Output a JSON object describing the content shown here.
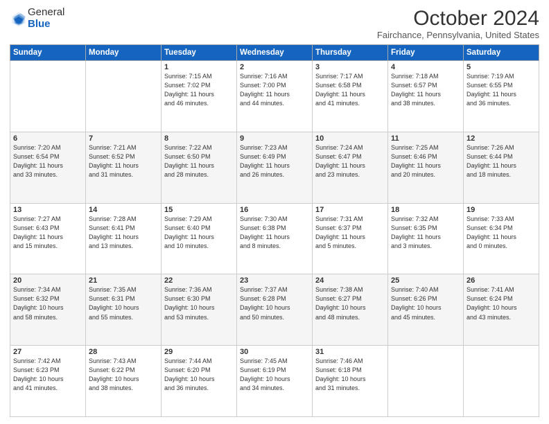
{
  "header": {
    "logo_general": "General",
    "logo_blue": "Blue",
    "month_title": "October 2024",
    "location": "Fairchance, Pennsylvania, United States"
  },
  "days_of_week": [
    "Sunday",
    "Monday",
    "Tuesday",
    "Wednesday",
    "Thursday",
    "Friday",
    "Saturday"
  ],
  "weeks": [
    [
      {
        "num": "",
        "info": ""
      },
      {
        "num": "",
        "info": ""
      },
      {
        "num": "1",
        "info": "Sunrise: 7:15 AM\nSunset: 7:02 PM\nDaylight: 11 hours\nand 46 minutes."
      },
      {
        "num": "2",
        "info": "Sunrise: 7:16 AM\nSunset: 7:00 PM\nDaylight: 11 hours\nand 44 minutes."
      },
      {
        "num": "3",
        "info": "Sunrise: 7:17 AM\nSunset: 6:58 PM\nDaylight: 11 hours\nand 41 minutes."
      },
      {
        "num": "4",
        "info": "Sunrise: 7:18 AM\nSunset: 6:57 PM\nDaylight: 11 hours\nand 38 minutes."
      },
      {
        "num": "5",
        "info": "Sunrise: 7:19 AM\nSunset: 6:55 PM\nDaylight: 11 hours\nand 36 minutes."
      }
    ],
    [
      {
        "num": "6",
        "info": "Sunrise: 7:20 AM\nSunset: 6:54 PM\nDaylight: 11 hours\nand 33 minutes."
      },
      {
        "num": "7",
        "info": "Sunrise: 7:21 AM\nSunset: 6:52 PM\nDaylight: 11 hours\nand 31 minutes."
      },
      {
        "num": "8",
        "info": "Sunrise: 7:22 AM\nSunset: 6:50 PM\nDaylight: 11 hours\nand 28 minutes."
      },
      {
        "num": "9",
        "info": "Sunrise: 7:23 AM\nSunset: 6:49 PM\nDaylight: 11 hours\nand 26 minutes."
      },
      {
        "num": "10",
        "info": "Sunrise: 7:24 AM\nSunset: 6:47 PM\nDaylight: 11 hours\nand 23 minutes."
      },
      {
        "num": "11",
        "info": "Sunrise: 7:25 AM\nSunset: 6:46 PM\nDaylight: 11 hours\nand 20 minutes."
      },
      {
        "num": "12",
        "info": "Sunrise: 7:26 AM\nSunset: 6:44 PM\nDaylight: 11 hours\nand 18 minutes."
      }
    ],
    [
      {
        "num": "13",
        "info": "Sunrise: 7:27 AM\nSunset: 6:43 PM\nDaylight: 11 hours\nand 15 minutes."
      },
      {
        "num": "14",
        "info": "Sunrise: 7:28 AM\nSunset: 6:41 PM\nDaylight: 11 hours\nand 13 minutes."
      },
      {
        "num": "15",
        "info": "Sunrise: 7:29 AM\nSunset: 6:40 PM\nDaylight: 11 hours\nand 10 minutes."
      },
      {
        "num": "16",
        "info": "Sunrise: 7:30 AM\nSunset: 6:38 PM\nDaylight: 11 hours\nand 8 minutes."
      },
      {
        "num": "17",
        "info": "Sunrise: 7:31 AM\nSunset: 6:37 PM\nDaylight: 11 hours\nand 5 minutes."
      },
      {
        "num": "18",
        "info": "Sunrise: 7:32 AM\nSunset: 6:35 PM\nDaylight: 11 hours\nand 3 minutes."
      },
      {
        "num": "19",
        "info": "Sunrise: 7:33 AM\nSunset: 6:34 PM\nDaylight: 11 hours\nand 0 minutes."
      }
    ],
    [
      {
        "num": "20",
        "info": "Sunrise: 7:34 AM\nSunset: 6:32 PM\nDaylight: 10 hours\nand 58 minutes."
      },
      {
        "num": "21",
        "info": "Sunrise: 7:35 AM\nSunset: 6:31 PM\nDaylight: 10 hours\nand 55 minutes."
      },
      {
        "num": "22",
        "info": "Sunrise: 7:36 AM\nSunset: 6:30 PM\nDaylight: 10 hours\nand 53 minutes."
      },
      {
        "num": "23",
        "info": "Sunrise: 7:37 AM\nSunset: 6:28 PM\nDaylight: 10 hours\nand 50 minutes."
      },
      {
        "num": "24",
        "info": "Sunrise: 7:38 AM\nSunset: 6:27 PM\nDaylight: 10 hours\nand 48 minutes."
      },
      {
        "num": "25",
        "info": "Sunrise: 7:40 AM\nSunset: 6:26 PM\nDaylight: 10 hours\nand 45 minutes."
      },
      {
        "num": "26",
        "info": "Sunrise: 7:41 AM\nSunset: 6:24 PM\nDaylight: 10 hours\nand 43 minutes."
      }
    ],
    [
      {
        "num": "27",
        "info": "Sunrise: 7:42 AM\nSunset: 6:23 PM\nDaylight: 10 hours\nand 41 minutes."
      },
      {
        "num": "28",
        "info": "Sunrise: 7:43 AM\nSunset: 6:22 PM\nDaylight: 10 hours\nand 38 minutes."
      },
      {
        "num": "29",
        "info": "Sunrise: 7:44 AM\nSunset: 6:20 PM\nDaylight: 10 hours\nand 36 minutes."
      },
      {
        "num": "30",
        "info": "Sunrise: 7:45 AM\nSunset: 6:19 PM\nDaylight: 10 hours\nand 34 minutes."
      },
      {
        "num": "31",
        "info": "Sunrise: 7:46 AM\nSunset: 6:18 PM\nDaylight: 10 hours\nand 31 minutes."
      },
      {
        "num": "",
        "info": ""
      },
      {
        "num": "",
        "info": ""
      }
    ]
  ]
}
